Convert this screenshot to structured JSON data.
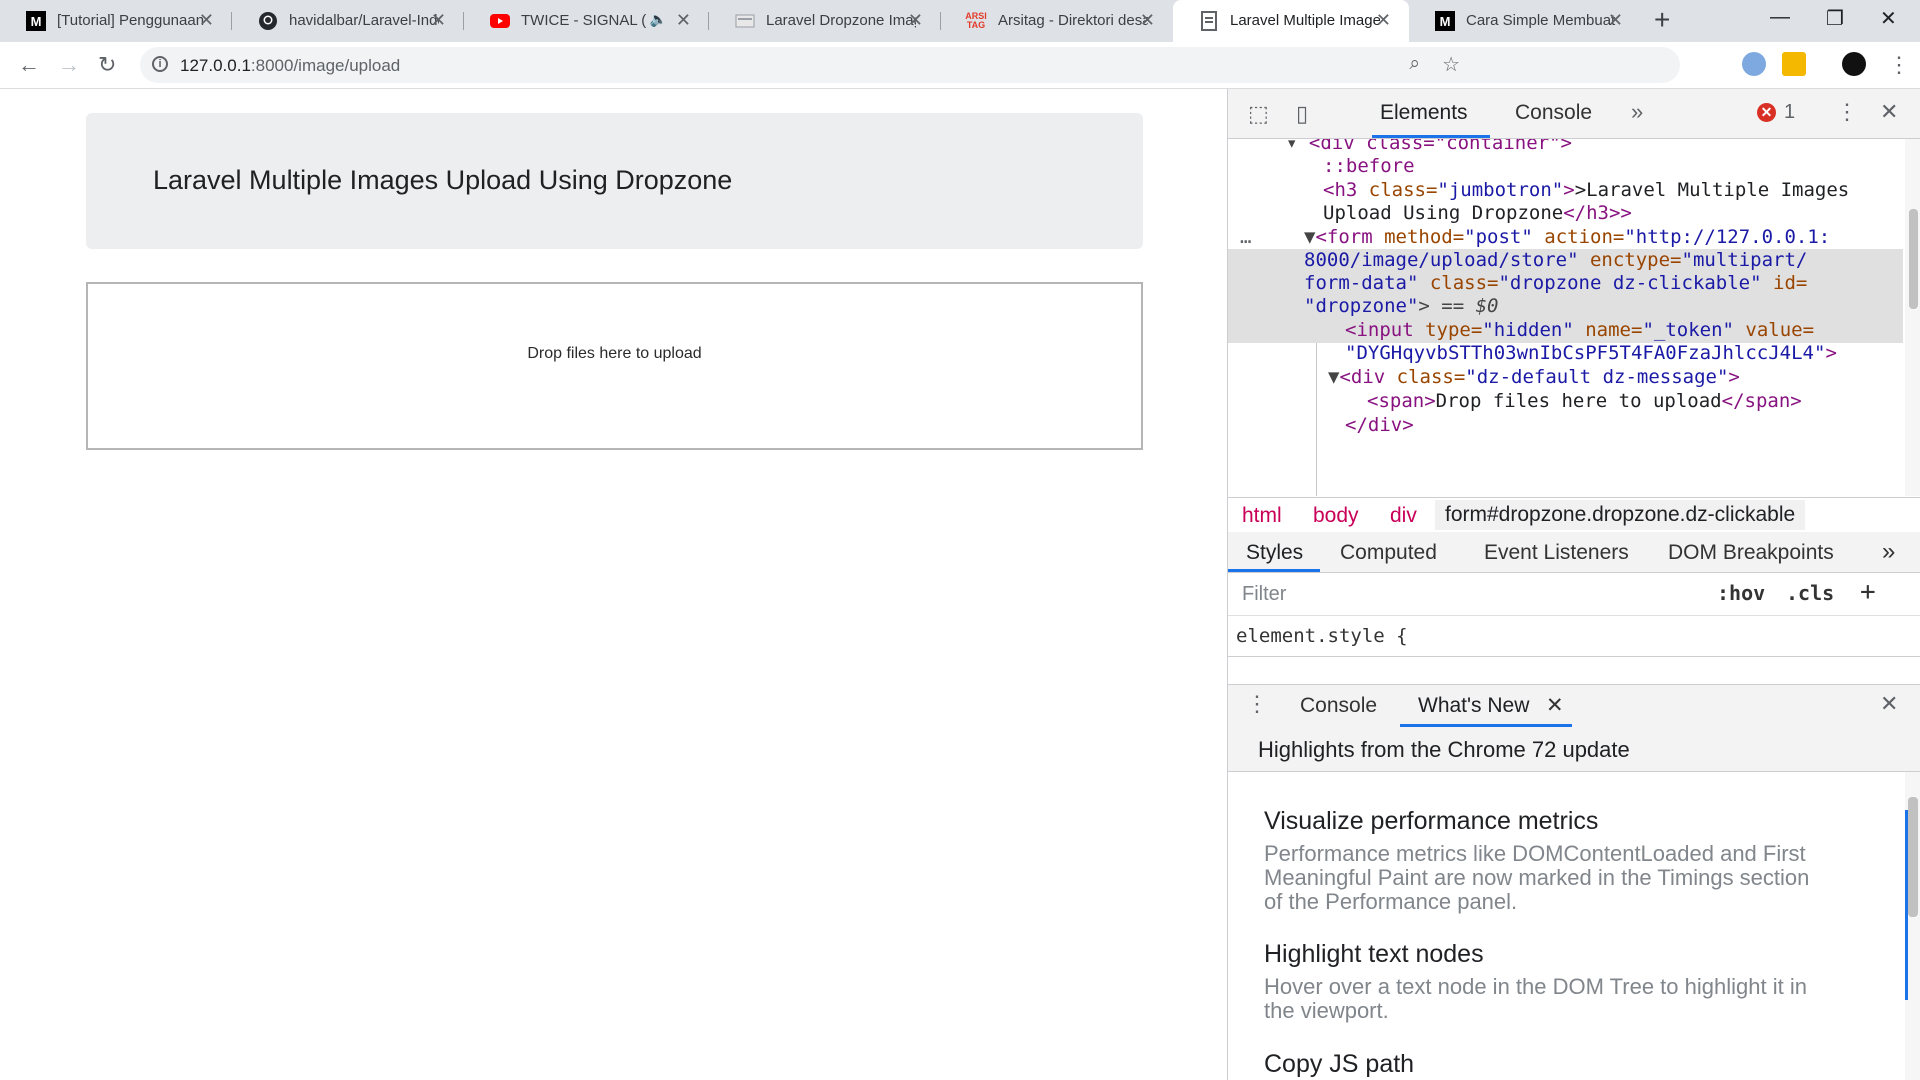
{
  "tabs": [
    {
      "title": "[Tutorial] Penggunaan",
      "favicon": "M",
      "active": false
    },
    {
      "title": "havidalbar/Laravel-Inde",
      "favicon": "github-icon",
      "active": false
    },
    {
      "title": "TWICE - SIGNAL (C",
      "favicon": "youtube-icon",
      "active": false,
      "audio": true
    },
    {
      "title": "Laravel Dropzone Imag",
      "favicon": "page-icon",
      "active": false
    },
    {
      "title": "Arsitag - Direktori desa",
      "favicon": "ARSI TAG",
      "active": false
    },
    {
      "title": "Laravel Multiple Image",
      "favicon": "doc-icon",
      "active": true
    },
    {
      "title": "Cara Simple Membuat",
      "favicon": "M",
      "active": false
    }
  ],
  "address": {
    "host": "127.0.0.1",
    "path": ":8000/image/upload"
  },
  "page": {
    "heading": "Laravel Multiple Images Upload Using Dropzone",
    "dropzone_message": "Drop files here to upload"
  },
  "devtools": {
    "tabs": [
      "Elements",
      "Console"
    ],
    "error_count": "1",
    "code": {
      "l0": "<div class=\"container\">",
      "before": "::before",
      "h3_open": "<h3 ",
      "h3_attr": "class=",
      "h3_val": "\"jumbotron\"",
      "h3_text": ">Laravel Multiple Images",
      "h3_text2": "Upload Using Dropzone",
      "h3_close": "</h3>",
      "form_tag": "<form ",
      "form_a1": "method=",
      "form_v1": "\"post\"",
      "form_a2": " action=",
      "form_v2": "\"http://127.0.0.1:",
      "form_v2b": "8000/image/upload/store\"",
      "form_a3": " enctype=",
      "form_v3": "\"multipart/",
      "form_v3b": "form-data\"",
      "form_a4": " class=",
      "form_v4": "\"dropzone dz-clickable\"",
      "form_a5": " id=",
      "form_v5": "\"dropzone\"",
      "form_eq": "> == $0",
      "input_tag": "<input ",
      "input_a1": "type=",
      "input_v1": "\"hidden\"",
      "input_a2": " name=",
      "input_v2": "\"_token\"",
      "input_a3": " value=",
      "input_v3": "\"DYGHqyvbSTTh03wnIbCsPF5T4FA0FzaJhlccJ4L4\"",
      "input_end": ">",
      "div_tag": "<div ",
      "div_a1": "class=",
      "div_v1": "\"dz-default dz-message\"",
      "div_end": ">",
      "span_open": "<span>",
      "span_text": "Drop files here to upload",
      "span_close": "</span>",
      "div_close": "</div>"
    },
    "breadcrumbs": [
      "html",
      "body",
      "div",
      "form#dropzone.dropzone.dz-clickable"
    ],
    "subtabs": [
      "Styles",
      "Computed",
      "Event Listeners",
      "DOM Breakpoints"
    ],
    "filter_placeholder": "Filter",
    "hov": ":hov",
    "cls": ".cls",
    "element_style": "element.style {",
    "drawer_tabs": [
      "Console",
      "What's New"
    ],
    "whats_new_header": "Highlights from the Chrome 72 update",
    "whats_new": [
      {
        "title": "Visualize performance metrics",
        "desc": "Performance metrics like DOMContentLoaded and First Meaningful Paint are now marked in the Timings section of the Performance panel."
      },
      {
        "title": "Highlight text nodes",
        "desc": "Hover over a text node in the DOM Tree to highlight it in the viewport."
      },
      {
        "title": "Copy JS path",
        "desc": ""
      }
    ]
  }
}
